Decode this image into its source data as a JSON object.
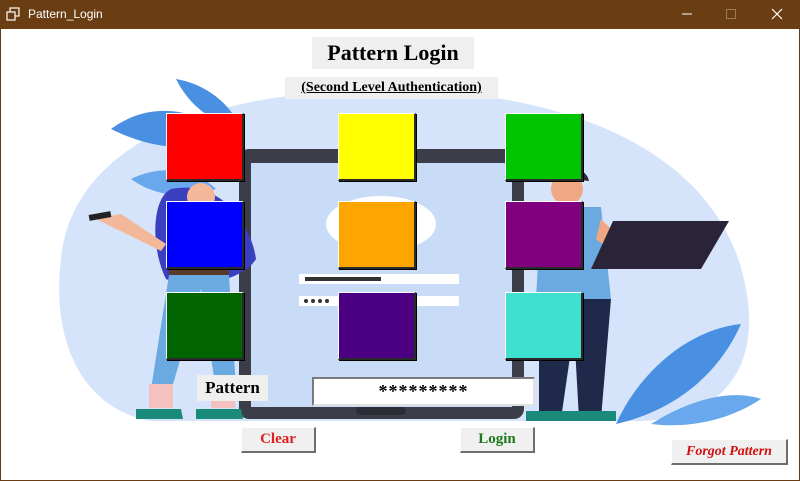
{
  "window": {
    "title": "Pattern_Login",
    "title_bar_color": "#6b3d13"
  },
  "header": {
    "title": "Pattern Login",
    "subtitle": "(Second Level Authentication)"
  },
  "pattern_grid": {
    "cells": [
      {
        "color": "#ff0000"
      },
      {
        "color": "#ffff00"
      },
      {
        "color": "#00c400"
      },
      {
        "color": "#0000ff"
      },
      {
        "color": "#ffa500"
      },
      {
        "color": "#800080"
      },
      {
        "color": "#006400"
      },
      {
        "color": "#4b0082"
      },
      {
        "color": "#40e0d0"
      }
    ]
  },
  "form": {
    "pattern_label": "Pattern",
    "pattern_value": "*********"
  },
  "buttons": {
    "clear": "Clear",
    "login": "Login",
    "forgot": "Forgot Pattern"
  },
  "icons": {
    "app": "restore-window-icon",
    "minimize": "minimize-icon",
    "maximize": "maximize-icon",
    "close": "close-icon"
  }
}
